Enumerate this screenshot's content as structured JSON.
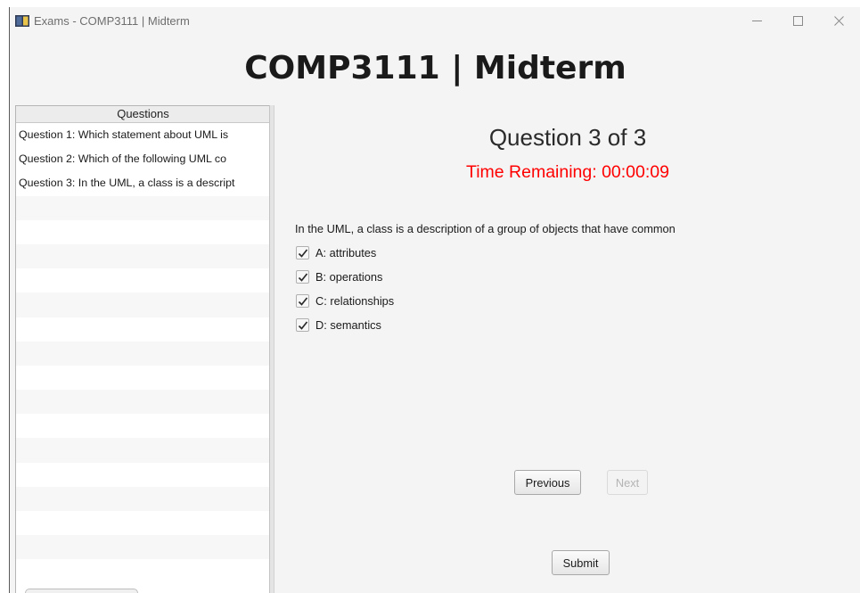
{
  "window": {
    "title": "Exams - COMP3111 | Midterm",
    "controls": [
      "minimize-icon",
      "maximize-icon",
      "close-icon"
    ]
  },
  "exam": {
    "title": "COMP3111 | Midterm"
  },
  "sidebar": {
    "header": "Questions",
    "items": [
      {
        "label": "Question 1: Which statement about UML is"
      },
      {
        "label": "Question 2: Which of the following UML co"
      },
      {
        "label": "Question 3: In the UML, a class is a descript"
      }
    ],
    "empty_rows": 15
  },
  "question": {
    "number_text": "Question 3 of 3",
    "timer_text": "Time Remaining: 00:00:09",
    "text": "In the UML, a class is a description of a group of objects that have common",
    "options": [
      {
        "label": "A: attributes",
        "checked": true
      },
      {
        "label": "B: operations",
        "checked": true
      },
      {
        "label": "C: relationships",
        "checked": true
      },
      {
        "label": "D: semantics",
        "checked": true
      }
    ]
  },
  "buttons": {
    "previous": "Previous",
    "next": "Next",
    "next_disabled": true,
    "submit": "Submit"
  },
  "colors": {
    "timer": "#ff0000",
    "window_bg": "#f4f4f4"
  }
}
